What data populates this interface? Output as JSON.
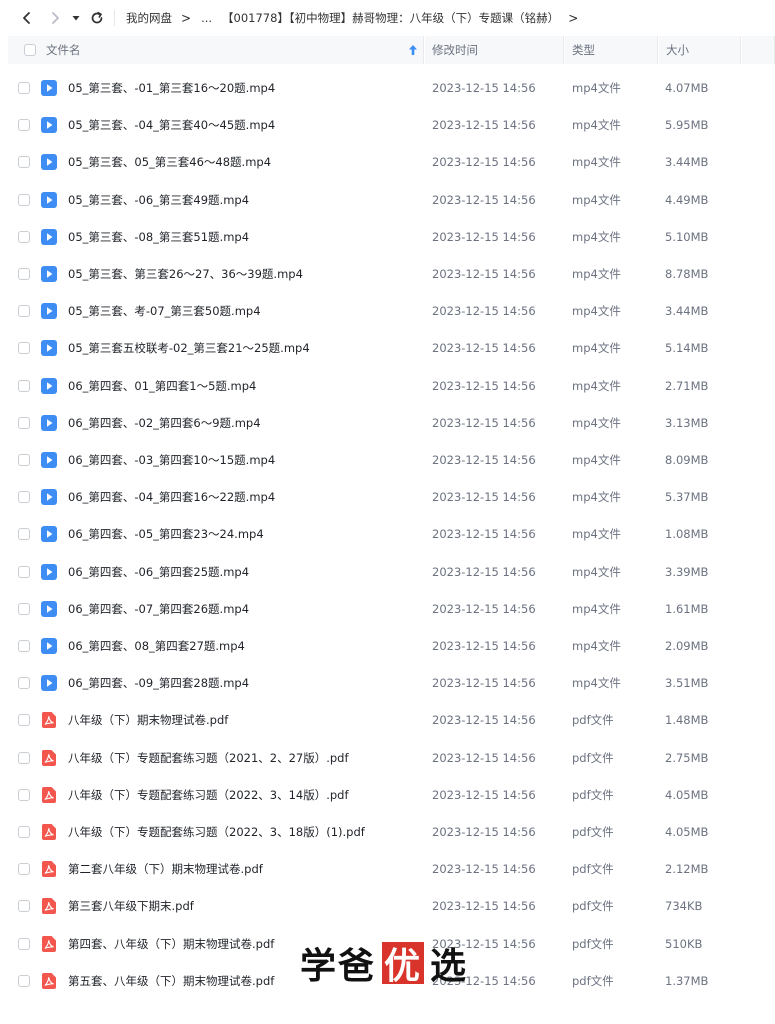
{
  "breadcrumb": {
    "root": "我的网盘",
    "ellipsis": "...",
    "current": "【001778】【初中物理】赫哥物理：八年级（下）专题课（铭赫）"
  },
  "columns": {
    "name": "文件名",
    "modified": "修改时间",
    "type": "类型",
    "size": "大小"
  },
  "files": [
    {
      "name": "05_第三套、-01_第三套16～20题.mp4",
      "time": "2023-12-15 14:56",
      "type": "mp4文件",
      "size": "4.07MB",
      "kind": "video"
    },
    {
      "name": "05_第三套、-04_第三套40～45题.mp4",
      "time": "2023-12-15 14:56",
      "type": "mp4文件",
      "size": "5.95MB",
      "kind": "video"
    },
    {
      "name": "05_第三套、05_第三套46～48题.mp4",
      "time": "2023-12-15 14:56",
      "type": "mp4文件",
      "size": "3.44MB",
      "kind": "video"
    },
    {
      "name": "05_第三套、-06_第三套49题.mp4",
      "time": "2023-12-15 14:56",
      "type": "mp4文件",
      "size": "4.49MB",
      "kind": "video"
    },
    {
      "name": "05_第三套、-08_第三套51题.mp4",
      "time": "2023-12-15 14:56",
      "type": "mp4文件",
      "size": "5.10MB",
      "kind": "video"
    },
    {
      "name": "05_第三套、第三套26～27、36～39题.mp4",
      "time": "2023-12-15 14:56",
      "type": "mp4文件",
      "size": "8.78MB",
      "kind": "video"
    },
    {
      "name": "05_第三套、考-07_第三套50题.mp4",
      "time": "2023-12-15 14:56",
      "type": "mp4文件",
      "size": "3.44MB",
      "kind": "video"
    },
    {
      "name": "05_第三套五校联考-02_第三套21～25题.mp4",
      "time": "2023-12-15 14:56",
      "type": "mp4文件",
      "size": "5.14MB",
      "kind": "video"
    },
    {
      "name": "06_第四套、01_第四套1～5题.mp4",
      "time": "2023-12-15 14:56",
      "type": "mp4文件",
      "size": "2.71MB",
      "kind": "video"
    },
    {
      "name": "06_第四套、-02_第四套6～9题.mp4",
      "time": "2023-12-15 14:56",
      "type": "mp4文件",
      "size": "3.13MB",
      "kind": "video"
    },
    {
      "name": "06_第四套、-03_第四套10～15题.mp4",
      "time": "2023-12-15 14:56",
      "type": "mp4文件",
      "size": "8.09MB",
      "kind": "video"
    },
    {
      "name": "06_第四套、-04_第四套16～22题.mp4",
      "time": "2023-12-15 14:56",
      "type": "mp4文件",
      "size": "5.37MB",
      "kind": "video"
    },
    {
      "name": "06_第四套、-05_第四套23～24.mp4",
      "time": "2023-12-15 14:56",
      "type": "mp4文件",
      "size": "1.08MB",
      "kind": "video"
    },
    {
      "name": "06_第四套、-06_第四套25题.mp4",
      "time": "2023-12-15 14:56",
      "type": "mp4文件",
      "size": "3.39MB",
      "kind": "video"
    },
    {
      "name": "06_第四套、-07_第四套26题.mp4",
      "time": "2023-12-15 14:56",
      "type": "mp4文件",
      "size": "1.61MB",
      "kind": "video"
    },
    {
      "name": "06_第四套、08_第四套27题.mp4",
      "time": "2023-12-15 14:56",
      "type": "mp4文件",
      "size": "2.09MB",
      "kind": "video"
    },
    {
      "name": "06_第四套、-09_第四套28题.mp4",
      "time": "2023-12-15 14:56",
      "type": "mp4文件",
      "size": "3.51MB",
      "kind": "video"
    },
    {
      "name": "八年级（下）期末物理试卷.pdf",
      "time": "2023-12-15 14:56",
      "type": "pdf文件",
      "size": "1.48MB",
      "kind": "pdf"
    },
    {
      "name": "八年级（下）专题配套练习题（2021、2、27版）.pdf",
      "time": "2023-12-15 14:56",
      "type": "pdf文件",
      "size": "2.75MB",
      "kind": "pdf"
    },
    {
      "name": "八年级（下）专题配套练习题（2022、3、14版）.pdf",
      "time": "2023-12-15 14:56",
      "type": "pdf文件",
      "size": "4.05MB",
      "kind": "pdf"
    },
    {
      "name": "八年级（下）专题配套练习题（2022、3、18版）(1).pdf",
      "time": "2023-12-15 14:56",
      "type": "pdf文件",
      "size": "4.05MB",
      "kind": "pdf"
    },
    {
      "name": "第二套八年级（下）期末物理试卷.pdf",
      "time": "2023-12-15 14:56",
      "type": "pdf文件",
      "size": "2.12MB",
      "kind": "pdf"
    },
    {
      "name": "第三套八年级下期末.pdf",
      "time": "2023-12-15 14:56",
      "type": "pdf文件",
      "size": "734KB",
      "kind": "pdf"
    },
    {
      "name": "第四套、八年级（下）期末物理试卷.pdf",
      "time": "2023-12-15 14:56",
      "type": "pdf文件",
      "size": "510KB",
      "kind": "pdf"
    },
    {
      "name": "第五套、八年级（下）期末物理试卷.pdf",
      "time": "2023-12-15 14:56",
      "type": "pdf文件",
      "size": "1.37MB",
      "kind": "pdf"
    }
  ],
  "watermark": {
    "part1": "学爸",
    "part2": "优",
    "part3": "选"
  },
  "colors": {
    "video_icon": "#3d8df5",
    "pdf_icon": "#f2564d",
    "watermark_box": "#d9342b"
  }
}
